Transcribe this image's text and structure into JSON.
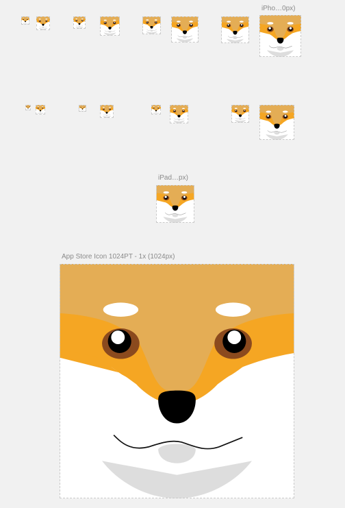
{
  "artboards": {
    "iphone_group_label": "iPho…0px)",
    "ipad_label": "iPad…px)",
    "appstore_label": "App Store Icon 1024PT - 1x (1024px)"
  },
  "icon": {
    "name": "shiba-face-icon",
    "colors": {
      "top": "#e4ad55",
      "orange": "#f5a623",
      "white": "#ffffff",
      "eye_ring": "#8b4a1e",
      "eye": "#000000",
      "nose": "#000000",
      "chin": "#dddddd",
      "brow": "#ffffff"
    }
  }
}
